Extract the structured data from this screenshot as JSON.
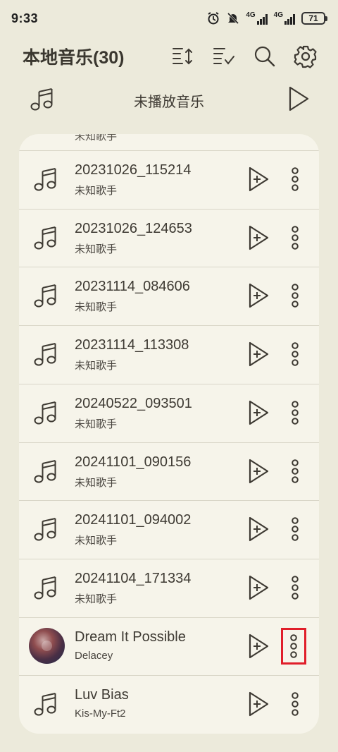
{
  "status_bar": {
    "time": "9:33",
    "network_1": "4G",
    "network_2": "4G",
    "battery": "71"
  },
  "header": {
    "title": "本地音乐(30)"
  },
  "unplayed": {
    "label": "未播放音乐"
  },
  "partial_row": {
    "text": "未知歌手"
  },
  "tracks": [
    {
      "title": "20231026_115214",
      "artist": "未知歌手"
    },
    {
      "title": "20231026_124653",
      "artist": "未知歌手"
    },
    {
      "title": "20231114_084606",
      "artist": "未知歌手"
    },
    {
      "title": "20231114_113308",
      "artist": "未知歌手"
    },
    {
      "title": "20240522_093501",
      "artist": "未知歌手"
    },
    {
      "title": "20241101_090156",
      "artist": "未知歌手"
    },
    {
      "title": "20241101_094002",
      "artist": "未知歌手"
    },
    {
      "title": "20241104_171334",
      "artist": "未知歌手"
    },
    {
      "title": "Dream It Possible",
      "artist": "Delacey"
    },
    {
      "title": "Luv Bias",
      "artist": "Kis-My-Ft2"
    }
  ],
  "colors": {
    "background": "#ECEADB",
    "card": "#F6F4EA",
    "highlight": "#E01E2A"
  }
}
